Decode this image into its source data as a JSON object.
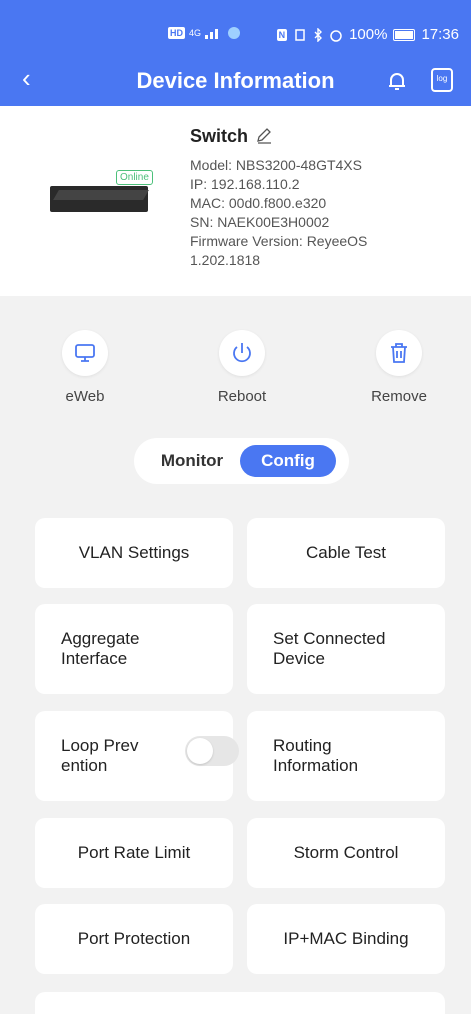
{
  "status_bar": {
    "left_chip": "HD",
    "network": "4G",
    "right_icons": "N",
    "battery": "100%",
    "time": "17:36"
  },
  "header": {
    "title": "Device Information",
    "back": "‹",
    "log_label": "log"
  },
  "device": {
    "name": "Switch",
    "online": "Online",
    "lines": [
      "Model: NBS3200-48GT4XS",
      "IP:  192.168.110.2",
      "MAC:  00d0.f800.e320",
      "SN: NAEK00E3H0002",
      "Firmware Version: ReyeeOS",
      "1.202.1818"
    ]
  },
  "actions": [
    {
      "label": "eWeb",
      "icon": "monitor-icon"
    },
    {
      "label": "Reboot",
      "icon": "power-icon"
    },
    {
      "label": "Remove",
      "icon": "trash-icon"
    }
  ],
  "tabs": {
    "monitor": "Monitor",
    "config": "Config",
    "selected": "Config"
  },
  "cards": [
    {
      "label": "VLAN Settings"
    },
    {
      "label": "Cable Test"
    },
    {
      "label": "Aggregate\nInterface"
    },
    {
      "label": "Set Connected\nDevice"
    },
    {
      "label": "Loop Prev\nention",
      "toggle": false
    },
    {
      "label": "Routing\nInformation"
    },
    {
      "label": "Port Rate Limit"
    },
    {
      "label": "Storm Control"
    },
    {
      "label": "Port Protection"
    },
    {
      "label": "IP+MAC Binding"
    }
  ],
  "colors": {
    "primary": "#4a77f2",
    "online": "#4cc07a",
    "background": "#f2f2f2"
  }
}
